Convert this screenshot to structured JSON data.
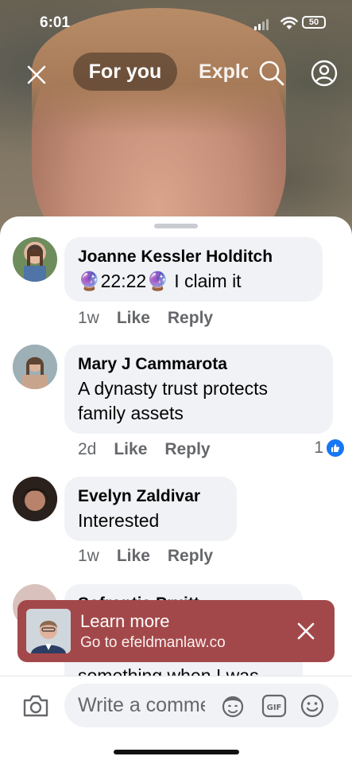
{
  "status_bar": {
    "time": "6:01",
    "battery": "50"
  },
  "top_nav": {
    "tab_active": "For you",
    "tab_next": "Explore"
  },
  "comments": [
    {
      "name": "Joanne Kessler Holditch",
      "text_prefix": "🔮",
      "text_time": "22:22",
      "text_suffix": "🔮 I claim it",
      "age": "1w",
      "like": "Like",
      "reply": "Reply"
    },
    {
      "name": "Mary J Cammarota",
      "text_line1": "A dynasty trust protects",
      "text_line2": "family assets",
      "age": "2d",
      "like": "Like",
      "reply": "Reply",
      "reactions": "1"
    },
    {
      "name": "Evelyn Zaldivar",
      "text": "Interested",
      "age": "1w",
      "like": "Like",
      "reply": "Reply"
    },
    {
      "name": "Sofrontis Pruitt",
      "text": "something when I was"
    }
  ],
  "ad": {
    "title": "Learn more",
    "subtitle": "Go to efeldmanlaw.co"
  },
  "composer": {
    "placeholder": "Write a comment..."
  },
  "colors": {
    "ad_bg": "#a3484a",
    "like_blue": "#1877f2",
    "bubble_bg": "#f0f2f5"
  }
}
